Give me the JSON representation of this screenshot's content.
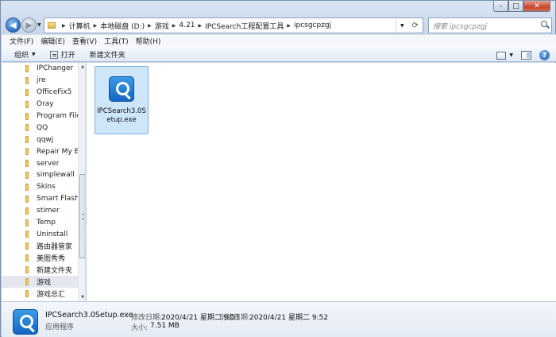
{
  "window": {
    "minimize": "–",
    "maximize": "□",
    "close": "✕"
  },
  "nav": {
    "back": "◀",
    "forward": "▶"
  },
  "address": {
    "crumbs": [
      "计算机",
      "本地磁盘 (D:)",
      "游戏",
      "4.21",
      "IPCSearch工程配置工具",
      "ipcsgcpzgj"
    ]
  },
  "search": {
    "placeholder": "搜索 ipcsgcpzgj"
  },
  "menu": [
    "文件(F)",
    "编辑(E)",
    "查看(V)",
    "工具(T)",
    "帮助(H)"
  ],
  "toolbar": {
    "organize": "组织",
    "open": "打开",
    "new_folder": "新建文件夹",
    "help": "?"
  },
  "nav_pane": {
    "items": [
      {
        "label": "IPChanger"
      },
      {
        "label": "jre"
      },
      {
        "label": "OfficeFix5"
      },
      {
        "label": "Oray"
      },
      {
        "label": "Program Files"
      },
      {
        "label": "QQ"
      },
      {
        "label": "qqwj"
      },
      {
        "label": "Repair My Exc"
      },
      {
        "label": "server"
      },
      {
        "label": "simplewall"
      },
      {
        "label": "Skins"
      },
      {
        "label": "Smart Flash R"
      },
      {
        "label": "stimer"
      },
      {
        "label": "Temp"
      },
      {
        "label": "Uninstall"
      },
      {
        "label": "路由器管家"
      },
      {
        "label": "美图秀秀"
      },
      {
        "label": "新建文件夹"
      },
      {
        "label": "游戏",
        "selected": true
      },
      {
        "label": "游戏总汇"
      }
    ]
  },
  "files": [
    {
      "name": "IPCSearch3.0Setup.exe",
      "icon": "app-search-icon",
      "selected": true
    }
  ],
  "details": {
    "name": "IPCSearch3.0Setup.exe",
    "type": "应用程序",
    "modified_label": "修改日期:",
    "modified": "2020/4/21 星期二 9:51",
    "created_label": "创建日期:",
    "created": "2020/4/21 星期二 9:52",
    "size_label": "大小:",
    "size": "7.51 MB"
  }
}
